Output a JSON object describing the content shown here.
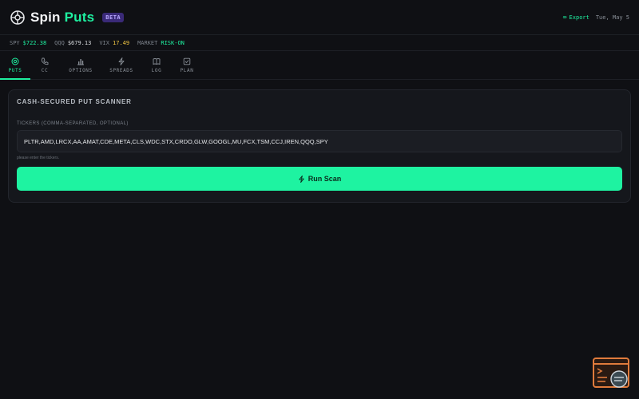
{
  "header": {
    "brand_spin": "Spin",
    "brand_puts": "Puts",
    "badge": "BETA",
    "export_label": "Export",
    "date": "Tue, May 5"
  },
  "ticker_strip": [
    {
      "symbol": "SPY",
      "value": "$722.38",
      "tone": "green"
    },
    {
      "symbol": "QQQ",
      "value": "$679.13",
      "tone": "white"
    },
    {
      "symbol": "VIX",
      "value": "17.49",
      "tone": "yellow"
    },
    {
      "symbol": "MARKET",
      "value": "RISK-ON",
      "tone": "green"
    }
  ],
  "tabs": [
    {
      "label": "PUTS",
      "icon": "target-icon",
      "active": true
    },
    {
      "label": "CC",
      "icon": "phone-icon",
      "active": false
    },
    {
      "label": "OPTIONS",
      "icon": "bar-chart-icon",
      "active": false
    },
    {
      "label": "SPREADS",
      "icon": "lightning-icon",
      "active": false
    },
    {
      "label": "LOG",
      "icon": "book-icon",
      "active": false
    },
    {
      "label": "PLAN",
      "icon": "checkbox-icon",
      "active": false
    }
  ],
  "scanner": {
    "title": "CASH-SECURED PUT SCANNER",
    "field_label": "TICKERS (COMMA-SEPARATED, OPTIONAL)",
    "tickers_value": "PLTR,AMD,LRCX,AA,AMAT,CDE,META,CLS,WDC,STX,CRDO,GLW,GOOGL,MU,FCX,TSM,CCJ,IREN,QQQ,SPY",
    "hint": "please enter the tickers.",
    "run_label": "Run Scan"
  },
  "colors": {
    "accent": "#1ef0a0",
    "background": "#0f1014",
    "card": "#15171c",
    "warning": "#f2c744",
    "beta_badge": "#3a2a78"
  }
}
